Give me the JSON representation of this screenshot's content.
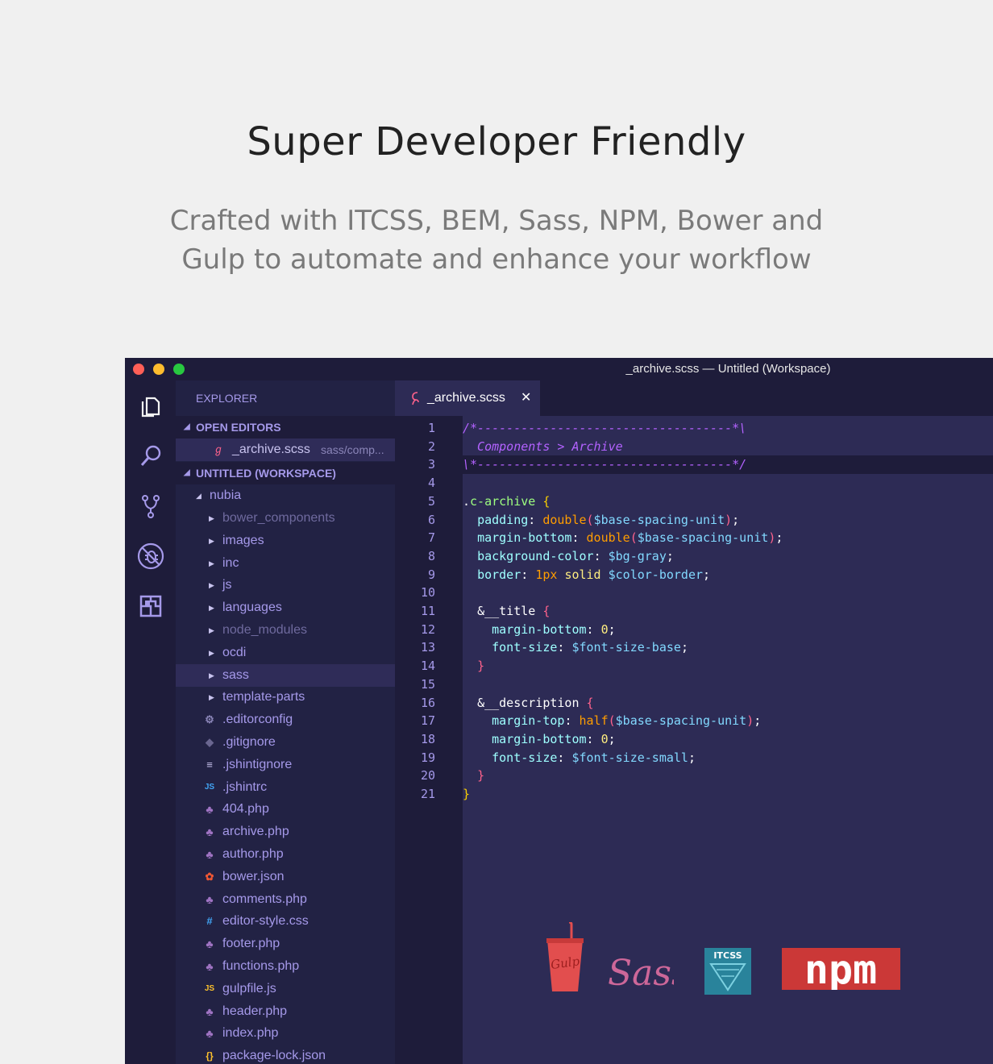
{
  "hero": {
    "title": "Super Developer Friendly",
    "subtitle_line1": "Crafted with ITCSS, BEM, Sass, NPM, Bower and",
    "subtitle_line2": "Gulp to automate and enhance your workflow"
  },
  "window": {
    "title": "_archive.scss — Untitled (Workspace)"
  },
  "activity_bar": [
    "files-icon",
    "search-icon",
    "source-control-icon",
    "debug-icon",
    "extensions-icon"
  ],
  "sidebar": {
    "title": "EXPLORER",
    "open_editors_label": "OPEN EDITORS",
    "open_editor": {
      "name": "_archive.scss",
      "path": "sass/comp..."
    },
    "workspace_label": "UNTITLED (WORKSPACE)",
    "root": "nubia",
    "folders": [
      {
        "name": "bower_components",
        "dim": true
      },
      {
        "name": "images",
        "dim": false
      },
      {
        "name": "inc",
        "dim": false
      },
      {
        "name": "js",
        "dim": false
      },
      {
        "name": "languages",
        "dim": false
      },
      {
        "name": "node_modules",
        "dim": true
      },
      {
        "name": "ocdi",
        "dim": false
      },
      {
        "name": "sass",
        "dim": false
      },
      {
        "name": "template-parts",
        "dim": false
      }
    ],
    "files": [
      {
        "name": ".editorconfig",
        "icon": "gear-icon"
      },
      {
        "name": ".gitignore",
        "icon": "git-icon"
      },
      {
        "name": ".jshintignore",
        "icon": "lines-icon"
      },
      {
        "name": ".jshintrc",
        "icon": "js-icon"
      },
      {
        "name": "404.php",
        "icon": "php-icon"
      },
      {
        "name": "archive.php",
        "icon": "php-icon"
      },
      {
        "name": "author.php",
        "icon": "php-icon"
      },
      {
        "name": "bower.json",
        "icon": "bower-icon"
      },
      {
        "name": "comments.php",
        "icon": "php-icon"
      },
      {
        "name": "editor-style.css",
        "icon": "css-icon"
      },
      {
        "name": "footer.php",
        "icon": "php-icon"
      },
      {
        "name": "functions.php",
        "icon": "php-icon"
      },
      {
        "name": "gulpfile.js",
        "icon": "js-icon"
      },
      {
        "name": "header.php",
        "icon": "php-icon"
      },
      {
        "name": "index.php",
        "icon": "php-icon"
      },
      {
        "name": "package-lock.json",
        "icon": "json-icon"
      }
    ]
  },
  "editor": {
    "tab_name": "_archive.scss",
    "lines": [
      "/*-----------------------------------*\\",
      "  Components > Archive",
      "\\*-----------------------------------*/",
      "",
      ".c-archive {",
      "  padding: double($base-spacing-unit);",
      "  margin-bottom: double($base-spacing-unit);",
      "  background-color: $bg-gray;",
      "  border: 1px solid $color-border;",
      "",
      "  &__title {",
      "    margin-bottom: 0;",
      "    font-size: $font-size-base;",
      "  }",
      "",
      "  &__description {",
      "    margin-top: half($base-spacing-unit);",
      "    margin-bottom: 0;",
      "    font-size: $font-size-small;",
      "  }",
      "}"
    ]
  },
  "logos": {
    "gulp_text": "Gulp",
    "sass_text": "Sass",
    "itcss_text": "ITCSS",
    "npm_text": "npm"
  },
  "colors": {
    "bg_page": "#f0f0f0",
    "editor_bg": "#2d2b55",
    "sidebar_bg": "#222244",
    "accent": "#a599e9"
  }
}
